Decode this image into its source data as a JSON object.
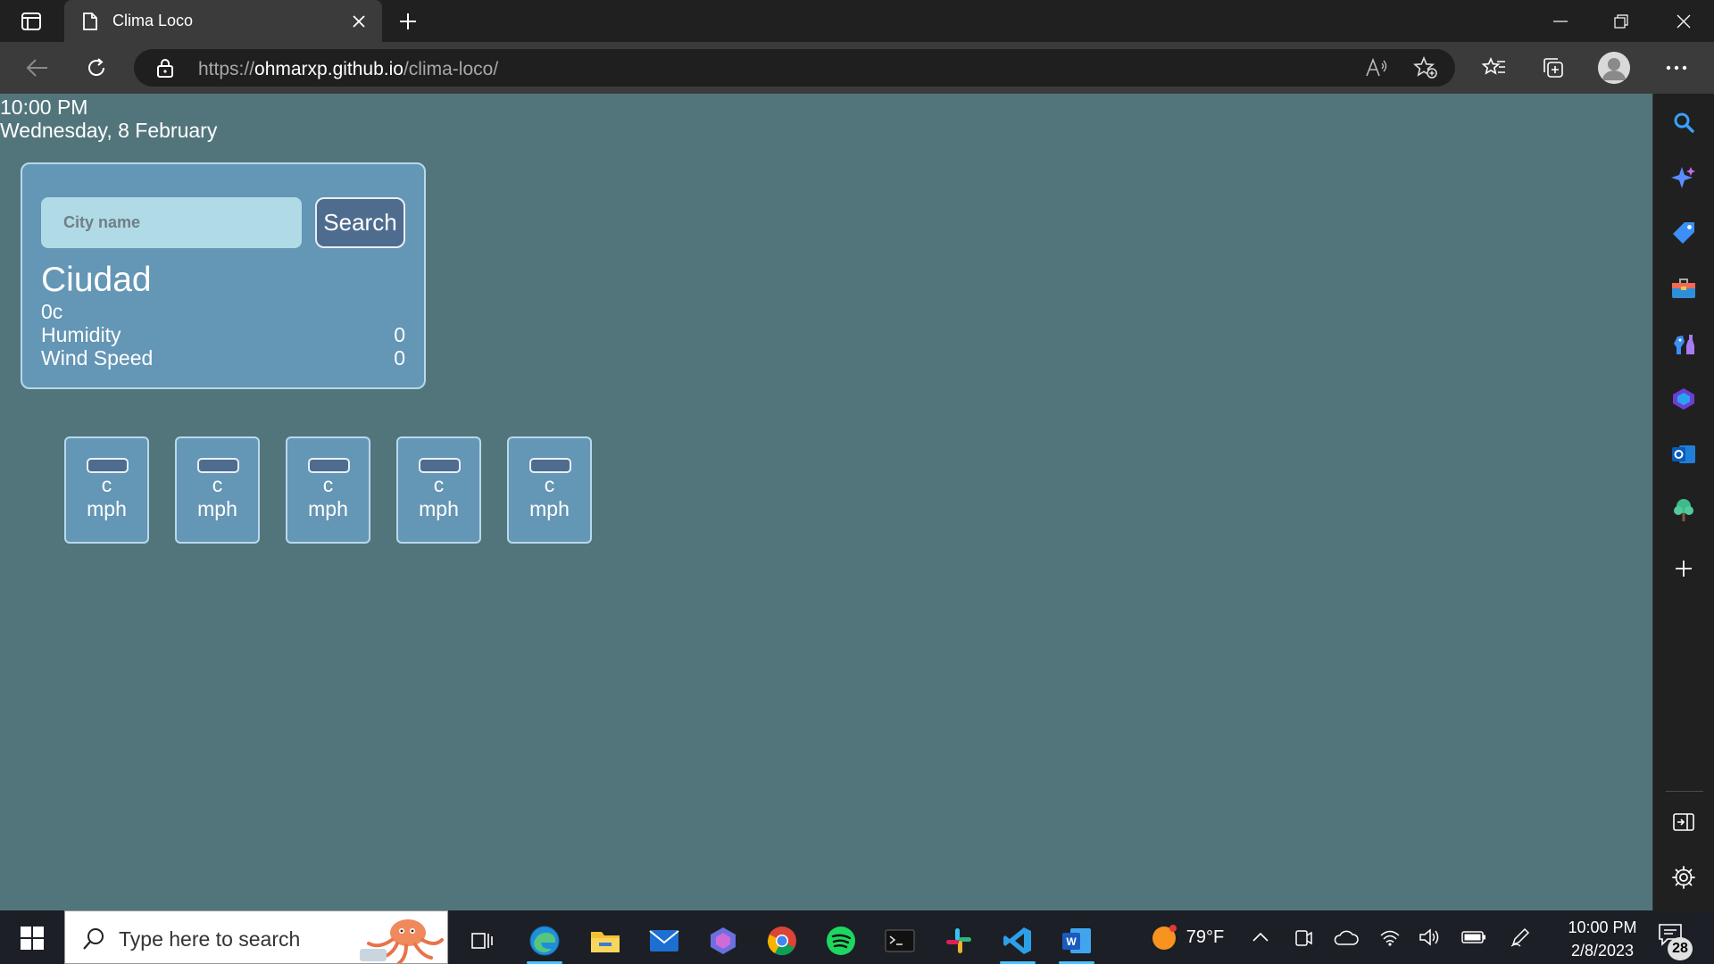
{
  "browser": {
    "tab_title": "Clima Loco",
    "url_scheme": "https://",
    "url_host": "ohmarxp.github.io",
    "url_path": "/clima-loco/"
  },
  "page": {
    "time": "10:00 PM",
    "date": "Wednesday, 8 February",
    "search": {
      "placeholder": "City name",
      "value": "",
      "button_label": "Search"
    },
    "current": {
      "city": "Ciudad",
      "temperature": "0c",
      "humidity_label": "Humidity",
      "humidity_value": "0",
      "wind_label": "Wind Speed",
      "wind_value": "0"
    },
    "forecast": [
      {
        "temp": "c",
        "wind": "mph"
      },
      {
        "temp": "c",
        "wind": "mph"
      },
      {
        "temp": "c",
        "wind": "mph"
      },
      {
        "temp": "c",
        "wind": "mph"
      },
      {
        "temp": "c",
        "wind": "mph"
      }
    ]
  },
  "taskbar": {
    "search_placeholder": "Type here to search",
    "weather": "79°F",
    "clock_time": "10:00 PM",
    "clock_date": "2/8/2023",
    "notification_count": "28"
  },
  "colors": {
    "page_background": "#52757c",
    "card_background": "#6496b5",
    "button_background": "#4e6c8e",
    "input_background": "#b0dbe6"
  }
}
